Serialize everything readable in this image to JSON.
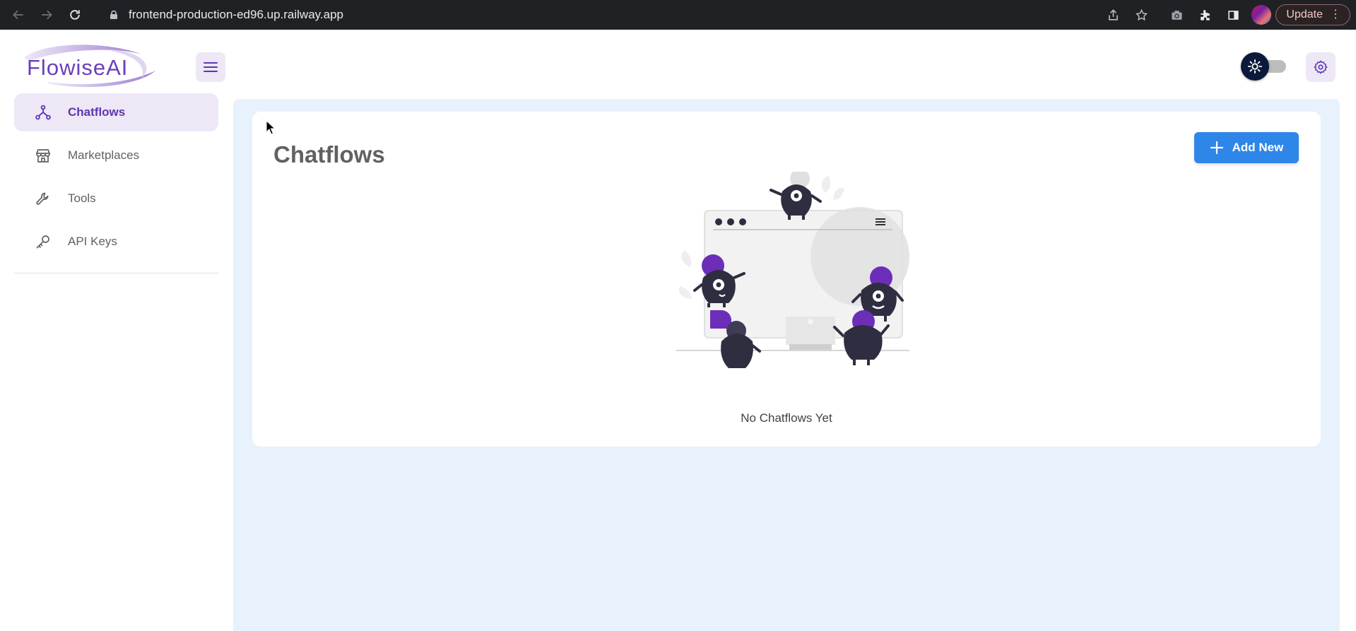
{
  "browser": {
    "url": "frontend-production-ed96.up.railway.app",
    "update_label": "Update",
    "icons": [
      "back-icon",
      "forward-icon",
      "reload-icon",
      "lock-icon",
      "share-icon",
      "star-icon",
      "camera-icon",
      "extensions-icon",
      "sidepanel-icon",
      "profile-avatar",
      "menu-dots-icon"
    ]
  },
  "header": {
    "logo_text": "FlowiseAI",
    "icons": [
      "hamburger-menu-icon",
      "sun-icon",
      "settings-gear-icon"
    ]
  },
  "sidebar": {
    "items": [
      {
        "label": "Chatflows",
        "icon": "chatflow-nodes-icon",
        "active": true
      },
      {
        "label": "Marketplaces",
        "icon": "store-icon",
        "active": false
      },
      {
        "label": "Tools",
        "icon": "wrench-icon",
        "active": false
      },
      {
        "label": "API Keys",
        "icon": "key-icon",
        "active": false
      }
    ]
  },
  "main": {
    "title": "Chatflows",
    "add_button_label": "Add New",
    "empty_state_text": "No Chatflows Yet"
  },
  "colors": {
    "accent_purple": "#5e35b1",
    "active_bg": "#ede7f6",
    "primary_blue": "#2e86e8",
    "main_bg": "#e8f2fc"
  }
}
